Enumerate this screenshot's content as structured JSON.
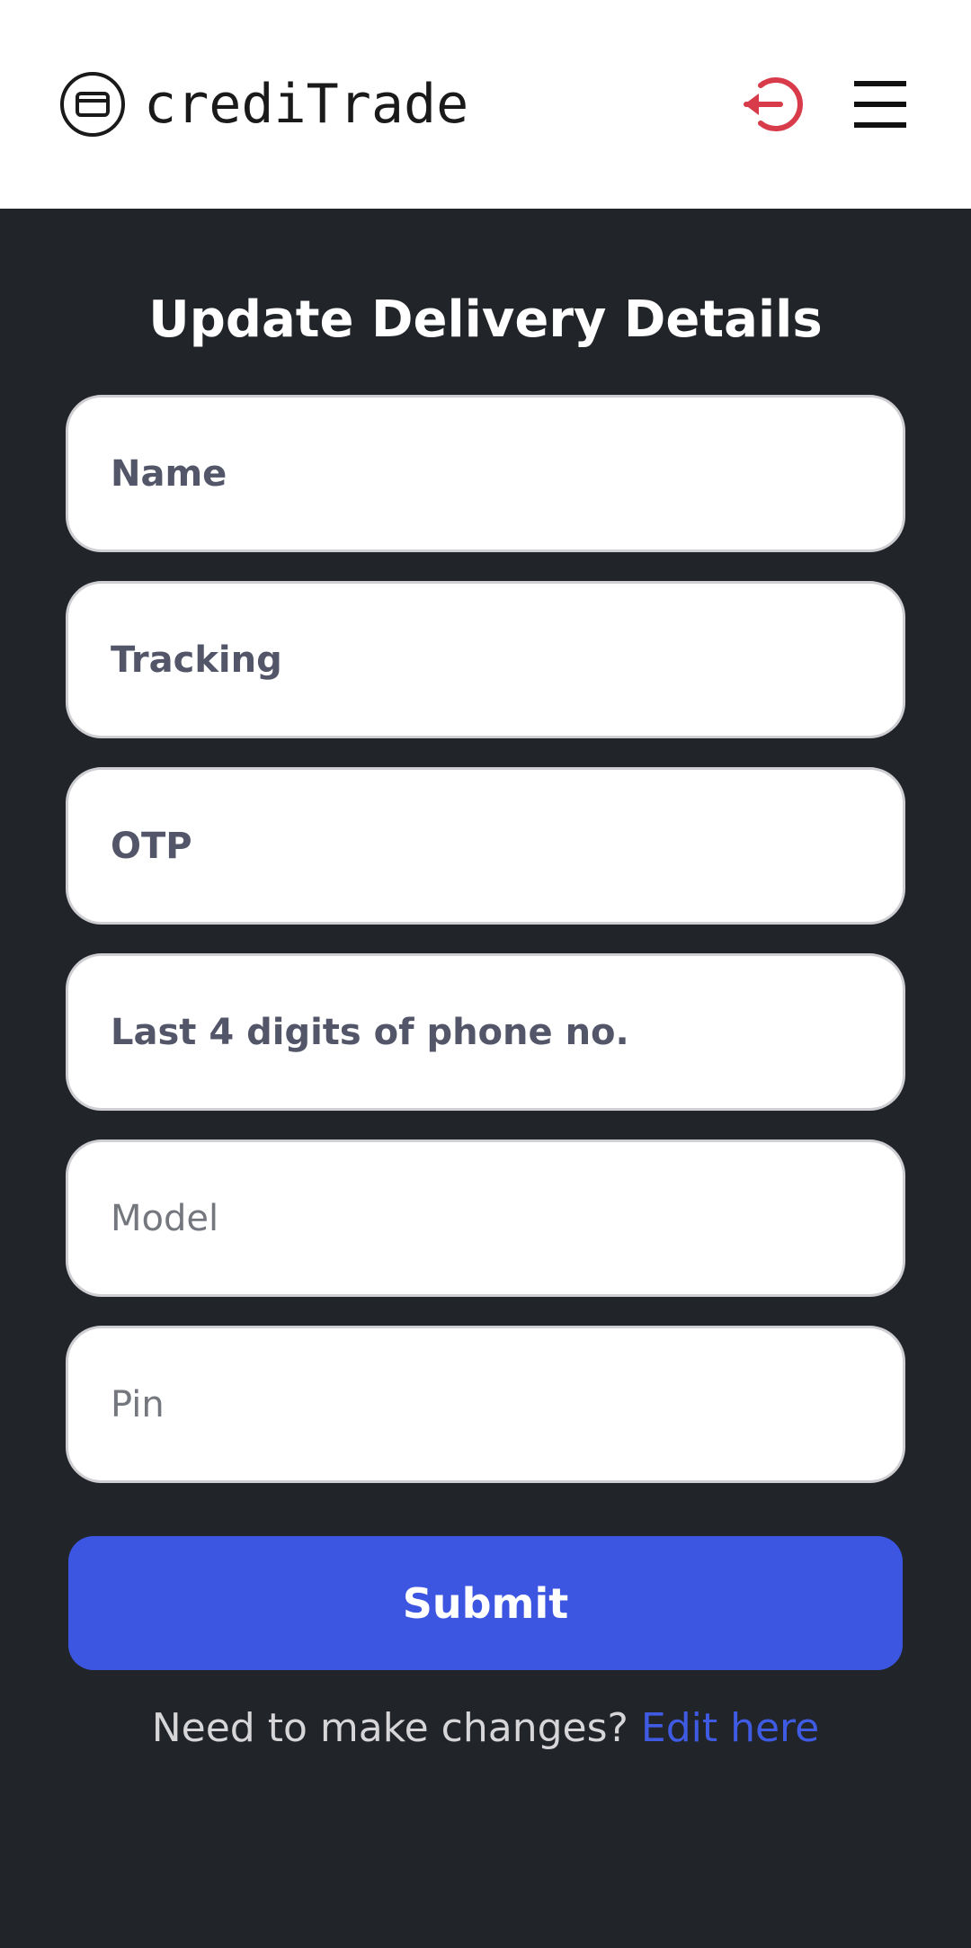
{
  "header": {
    "brand_name": "crediTrade",
    "brand_icon": "credit-card-icon",
    "logout_icon": "logout-icon",
    "menu_icon": "hamburger-menu-icon",
    "logout_color": "#d83b4a"
  },
  "form": {
    "title": "Update Delivery Details",
    "fields": [
      {
        "placeholder": "Name",
        "value": ""
      },
      {
        "placeholder": "Tracking",
        "value": ""
      },
      {
        "placeholder": "OTP",
        "value": ""
      },
      {
        "placeholder": "Last 4 digits of phone no.",
        "value": ""
      },
      {
        "placeholder": "Model",
        "value": ""
      },
      {
        "placeholder": "Pin",
        "value": ""
      }
    ],
    "submit_label": "Submit",
    "submit_color": "#3c56e2"
  },
  "footer": {
    "prompt": "Need to make changes?",
    "link_label": "Edit here",
    "link_color": "#3f5be4"
  }
}
